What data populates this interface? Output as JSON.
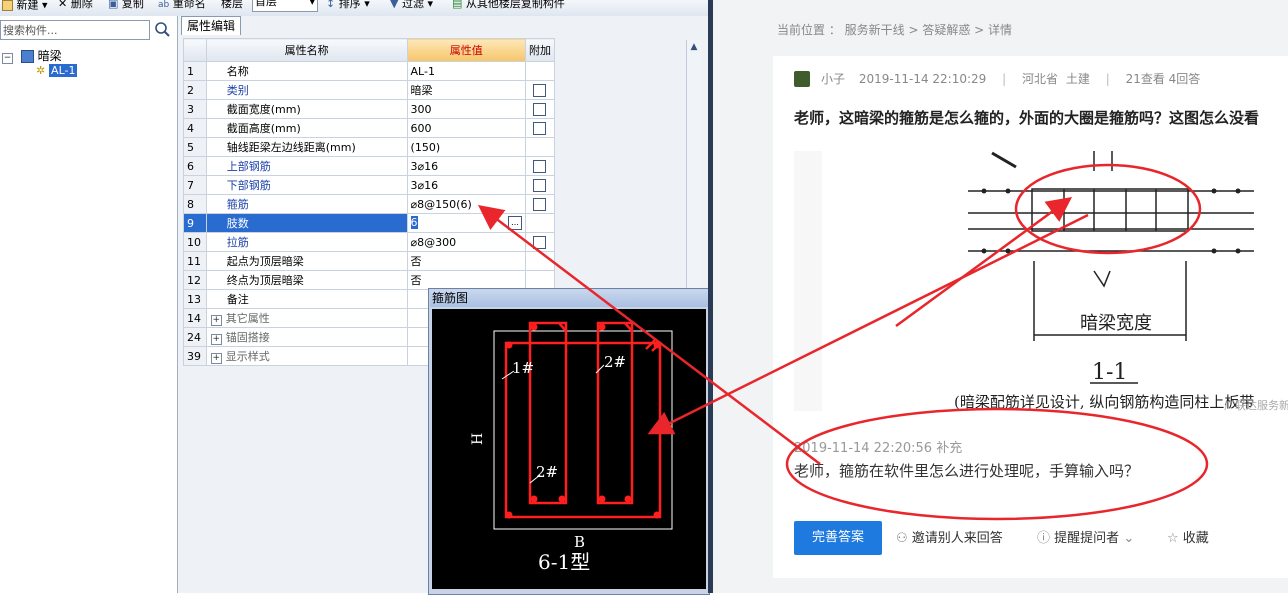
{
  "toolbar": {
    "new_label": "新建 ▾",
    "delete_label": "删除",
    "copy_label": "复制",
    "rename_label": "重命名",
    "floor_label": "楼层",
    "floor_value": "首层",
    "sort_label": "排序 ▾",
    "filter_label": "过滤 ▾",
    "copy_from_floor_label": "从其他楼层复制构件"
  },
  "search": {
    "placeholder": "搜索构件..."
  },
  "tree": {
    "root_label": "暗梁",
    "child_label": "AL-1"
  },
  "property_tab": "属性编辑",
  "grid": {
    "headers": {
      "name": "属性名称",
      "value": "属性值",
      "extra": "附加"
    },
    "rows": [
      {
        "num": "1",
        "name": "名称",
        "value": "AL-1"
      },
      {
        "num": "2",
        "name": "类别",
        "value": "暗梁"
      },
      {
        "num": "3",
        "name": "截面宽度(mm)",
        "value": "300"
      },
      {
        "num": "4",
        "name": "截面高度(mm)",
        "value": "600"
      },
      {
        "num": "5",
        "name": "轴线距梁左边线距离(mm)",
        "value": "(150)"
      },
      {
        "num": "6",
        "name": "上部钢筋",
        "value": "3⌀16"
      },
      {
        "num": "7",
        "name": "下部钢筋",
        "value": "3⌀16"
      },
      {
        "num": "8",
        "name": "箍筋",
        "value": "⌀8@150(6)"
      },
      {
        "num": "9",
        "name": "肢数",
        "value": "6"
      },
      {
        "num": "10",
        "name": "拉筋",
        "value": "⌀8@300"
      },
      {
        "num": "11",
        "name": "起点为顶层暗梁",
        "value": "否"
      },
      {
        "num": "12",
        "name": "终点为顶层暗梁",
        "value": "否"
      },
      {
        "num": "13",
        "name": "备注",
        "value": ""
      },
      {
        "num": "14",
        "name": "其它属性",
        "value": ""
      },
      {
        "num": "24",
        "name": "锚固搭接",
        "value": ""
      },
      {
        "num": "39",
        "name": "显示样式",
        "value": ""
      }
    ]
  },
  "stirrup_window": {
    "title": "箍筋图",
    "label_1": "1#",
    "label_2_top": "2#",
    "label_2_bottom": "2#",
    "h_label": "H",
    "b_label": "B",
    "type_label": "6-1型"
  },
  "web": {
    "breadcrumb": "当前位置 ： 服务新干线 > 答疑解惑 > 详情",
    "user": "小子",
    "post_time": "2019-11-14 22:10:29",
    "region": "河北省",
    "category": "土建",
    "stats": "21查看  4回答",
    "question": "老师，这暗梁的箍筋是怎么箍的，外面的大圈是箍筋吗？这图怎么没看",
    "figure": {
      "caption_width": "暗梁宽度",
      "caption_section": "1-1",
      "caption_note": "(暗梁配筋详见设计, 纵向钢筋构造同柱上板带",
      "watermark": "广联达服务新干线"
    },
    "answer_time": "2019-11-14 22:20:56 补充",
    "answer_text": "老师，箍筋在软件里怎么进行处理呢，手算输入吗？",
    "perfect_button": "完善答案",
    "invite_label": "邀请别人来回答",
    "remind_label": "提醒提问者",
    "collect_label": "收藏"
  },
  "colors": {
    "annotation_red": "#e8262b",
    "button_blue": "#1f7ae0",
    "grid_selected": "#2a6bd0"
  }
}
